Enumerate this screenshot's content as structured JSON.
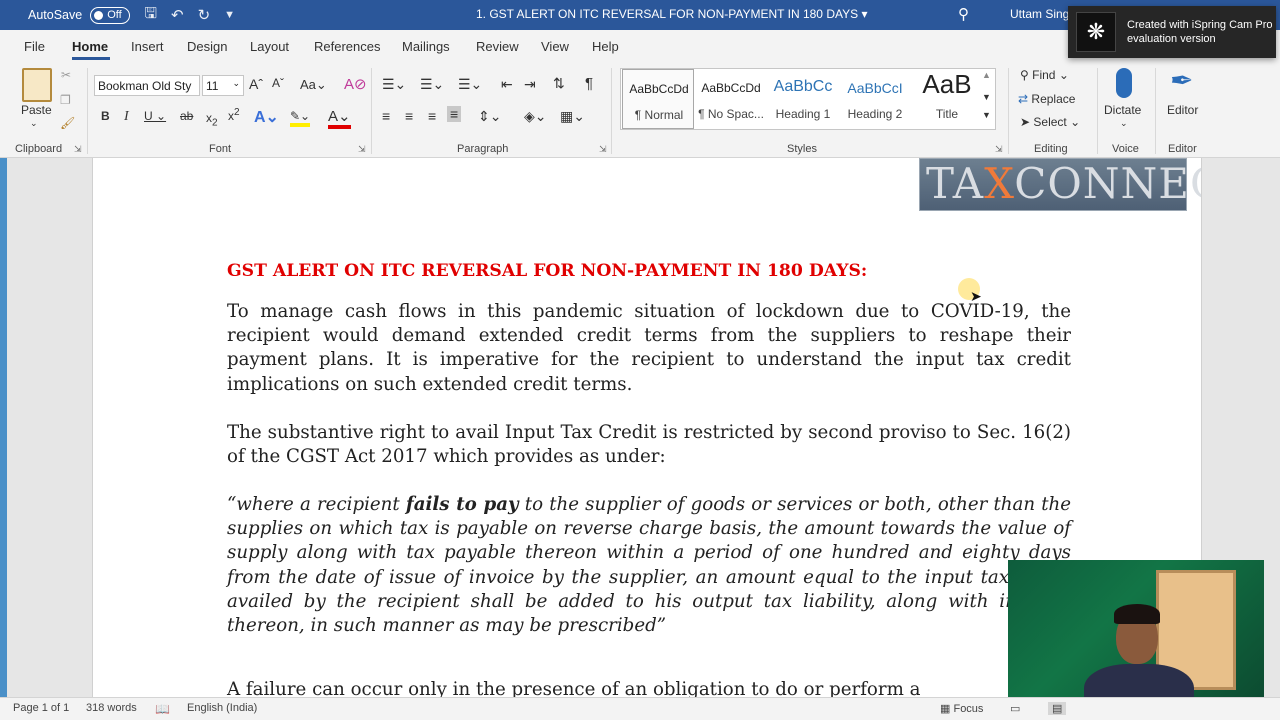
{
  "titlebar": {
    "autosave_label": "AutoSave",
    "autosave_state": "Off",
    "document_title": "1. GST ALERT ON ITC REVERSAL FOR NON-PAYMENT IN 180 DAYS",
    "user": "Uttam Sing",
    "bg_color": "#2b579a"
  },
  "menu": {
    "tabs": [
      "File",
      "Home",
      "Insert",
      "Design",
      "Layout",
      "References",
      "Mailings",
      "Review",
      "View",
      "Help"
    ],
    "active": "Home"
  },
  "ribbon": {
    "clipboard": {
      "paste_label": "Paste",
      "group": "Clipboard"
    },
    "font": {
      "name": "Bookman Old Sty",
      "size": "11",
      "group": "Font"
    },
    "paragraph": {
      "group": "Paragraph"
    },
    "styles": {
      "group": "Styles",
      "items": [
        {
          "sample": "AaBbCcDd",
          "name": "¶ Normal"
        },
        {
          "sample": "AaBbCcDd",
          "name": "¶ No Spac..."
        },
        {
          "sample": "AaBbCc",
          "name": "Heading 1"
        },
        {
          "sample": "AaBbCcI",
          "name": "Heading 2"
        },
        {
          "sample": "AaB",
          "name": "Title"
        }
      ]
    },
    "editing": {
      "find": "Find",
      "replace": "Replace",
      "select": "Select",
      "group": "Editing"
    },
    "voice": {
      "dictate": "Dictate",
      "group": "Voice"
    },
    "editor": {
      "label": "Editor",
      "group": "Editor"
    }
  },
  "notification": {
    "line1": "Created with iSpring Cam Pro",
    "line2": "evaluation version"
  },
  "document": {
    "logo_left": "TA",
    "logo_x": "X",
    "logo_right": "CONNECT",
    "heading": "GST ALERT ON ITC REVERSAL FOR NON-PAYMENT IN 180 DAYS:",
    "para1": "To manage cash flows in this pandemic situation of lockdown due to COVID-19, the recipient would demand extended credit terms from the suppliers to reshape their payment plans. It is imperative for the recipient to understand the input tax credit implications on such extended credit terms.",
    "para2": "The substantive right to avail Input Tax Credit is restricted by second proviso to Sec. 16(2) of the CGST Act 2017 which provides as under:",
    "quote_start": "“where a recipient ",
    "quote_bold": "fails to pay",
    "quote_rest": " to the supplier of goods or services or both, other than the supplies on which tax is payable on reverse charge basis, the amount towards the value of supply along with tax payable thereon within a period of one hundred and eighty days from the date of issue of invoice by the supplier, an amount equal to the input tax credit availed by the recipient shall be added to his output tax liability, along with interest thereon, in such manner as may be prescribed”",
    "para4": "A failure can occur only in the presence of an obligation to do or perform a"
  },
  "status": {
    "page": "Page 1 of 1",
    "words": "318 words",
    "language": "English (India)",
    "focus": "Focus"
  }
}
